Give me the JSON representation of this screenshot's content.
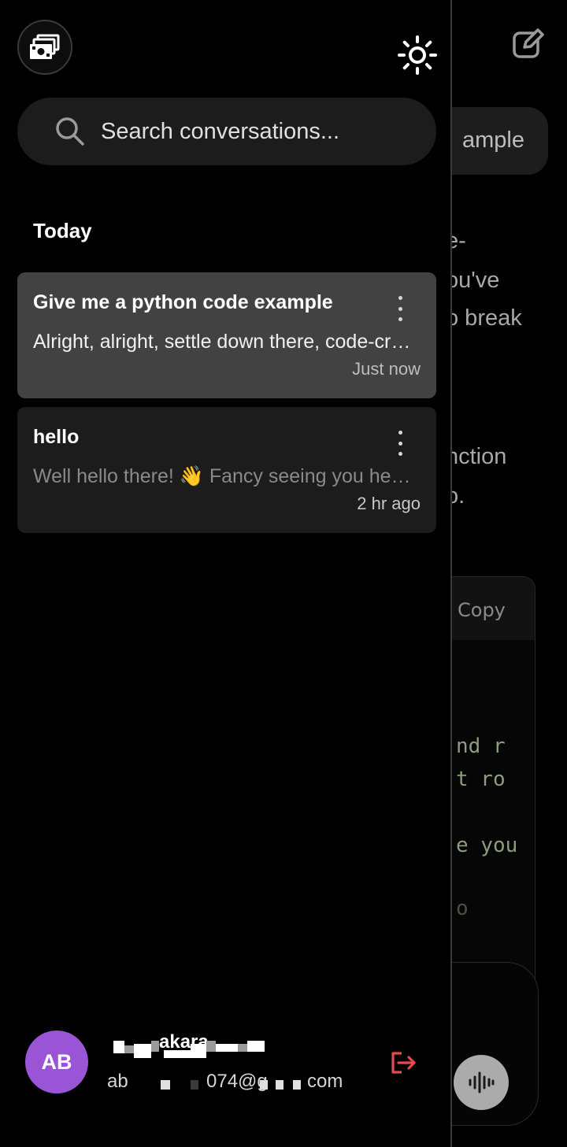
{
  "background_chat": {
    "title_fragment": "ample",
    "text_fragments": [
      "e-",
      "ou've",
      "o break",
      "nction",
      "o."
    ],
    "code_block": {
      "copy_label": "Copy",
      "code_fragments": [
        "nd r",
        "t ro",
        "e you",
        "o"
      ]
    },
    "icons": {
      "new_chat": "edit-square-icon",
      "voice": "voice-wave-icon"
    }
  },
  "sidebar": {
    "logo_icon": "money-stack-icon",
    "theme_toggle_icon": "sun-icon",
    "search": {
      "placeholder": "Search conversations...",
      "value": "",
      "icon": "search-icon"
    },
    "section_label": "Today",
    "conversations": [
      {
        "title": "Give me a python code example",
        "preview": "Alright, alright, settle down there, code-cr…",
        "time": "Just now",
        "active": true
      },
      {
        "title": "hello",
        "preview": "Well hello there! 👋 Fancy seeing you her…",
        "time": "2 hr ago",
        "active": false
      }
    ],
    "profile": {
      "initials": "AB",
      "avatar_color": "#9a55d6",
      "name_visible": "akara",
      "email_visible": [
        "ab",
        "074@g",
        "com"
      ],
      "logout_icon": "logout-icon",
      "logout_color": "#e5484d"
    }
  }
}
